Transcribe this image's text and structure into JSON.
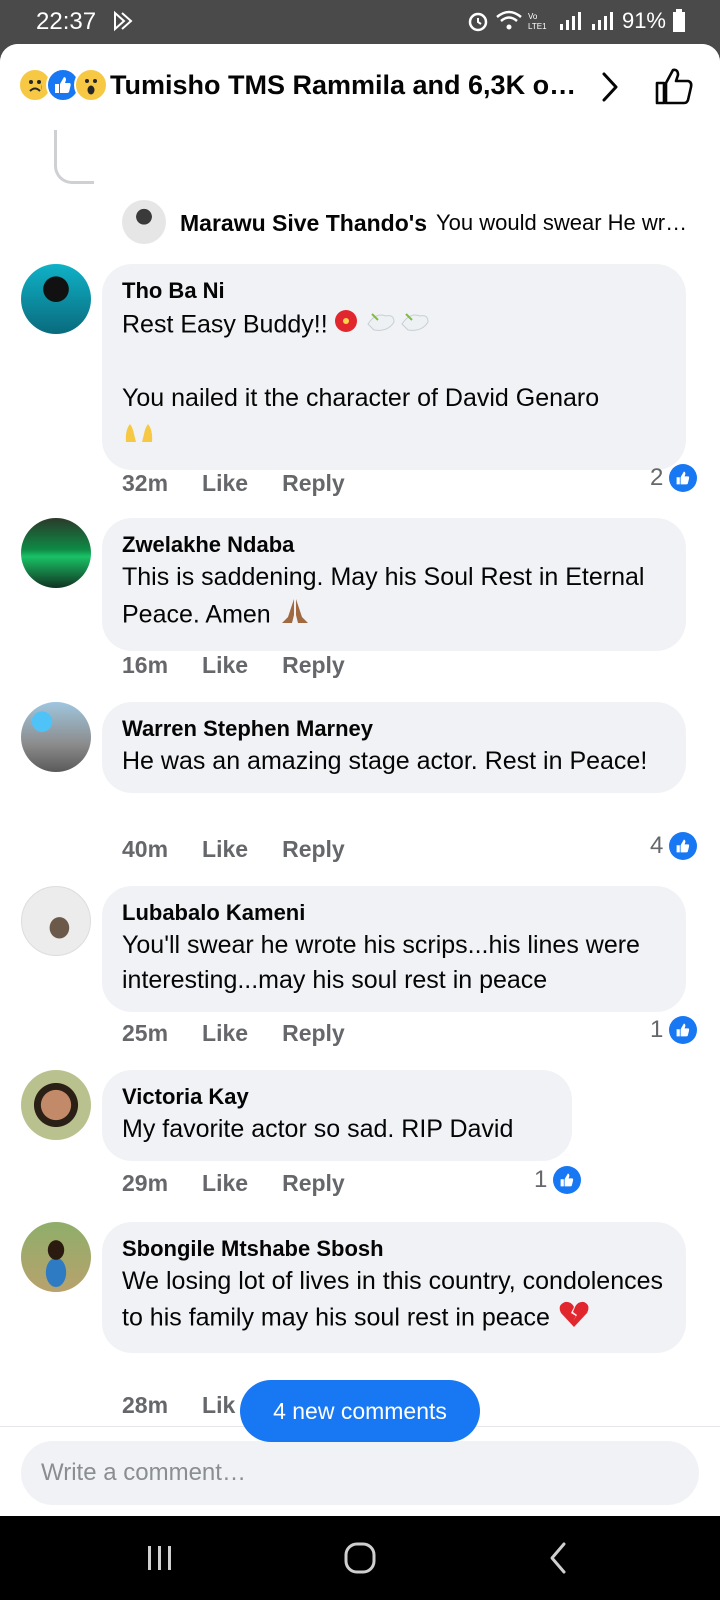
{
  "status_bar": {
    "time": "22:37",
    "battery": "91%"
  },
  "header": {
    "title": "Tumisho TMS Rammila and 6,3K ot…",
    "reaction_icons": [
      "sad-reaction-icon",
      "like-reaction-icon",
      "wow-reaction-icon"
    ]
  },
  "partial_reply": {
    "name": "Marawu Sive Thando's",
    "text": "You would swear He wr…"
  },
  "comments": [
    {
      "name": "Tho Ba Ni",
      "text": "Rest Easy Buddy!!",
      "text2": "You nailed it the character of David Genaro",
      "time": "32m",
      "like": "Like",
      "reply": "Reply",
      "likes": "2"
    },
    {
      "name": "Zwelakhe Ndaba",
      "text": "This is saddening. May his Soul Rest in Eternal Peace. Amen",
      "time": "16m",
      "like": "Like",
      "reply": "Reply",
      "likes": ""
    },
    {
      "name": "Warren Stephen Marney",
      "text": "He was an amazing stage actor. Rest in Peace!",
      "time": "40m",
      "like": "Like",
      "reply": "Reply",
      "likes": "4"
    },
    {
      "name": "Lubabalo Kameni",
      "text": "You'll swear he wrote his scrips...his lines were interesting...may his soul rest in peace",
      "time": "25m",
      "like": "Like",
      "reply": "Reply",
      "likes": "1"
    },
    {
      "name": "Victoria Kay",
      "text": "My favorite actor so sad. RIP David",
      "time": "29m",
      "like": "Like",
      "reply": "Reply",
      "likes": "1"
    },
    {
      "name": "Sbongile Mtshabe Sbosh",
      "text": "We losing lot of lives in this country, condolences to his family may his soul rest in peace",
      "time": "28m",
      "like": "Lik",
      "reply": "",
      "likes": ""
    }
  ],
  "new_comments_pill": "4 new comments",
  "composer": {
    "placeholder": "Write a comment…"
  },
  "colors": {
    "accent": "#1877f2",
    "bubble": "#f0f2f5",
    "meta": "#65676b"
  }
}
